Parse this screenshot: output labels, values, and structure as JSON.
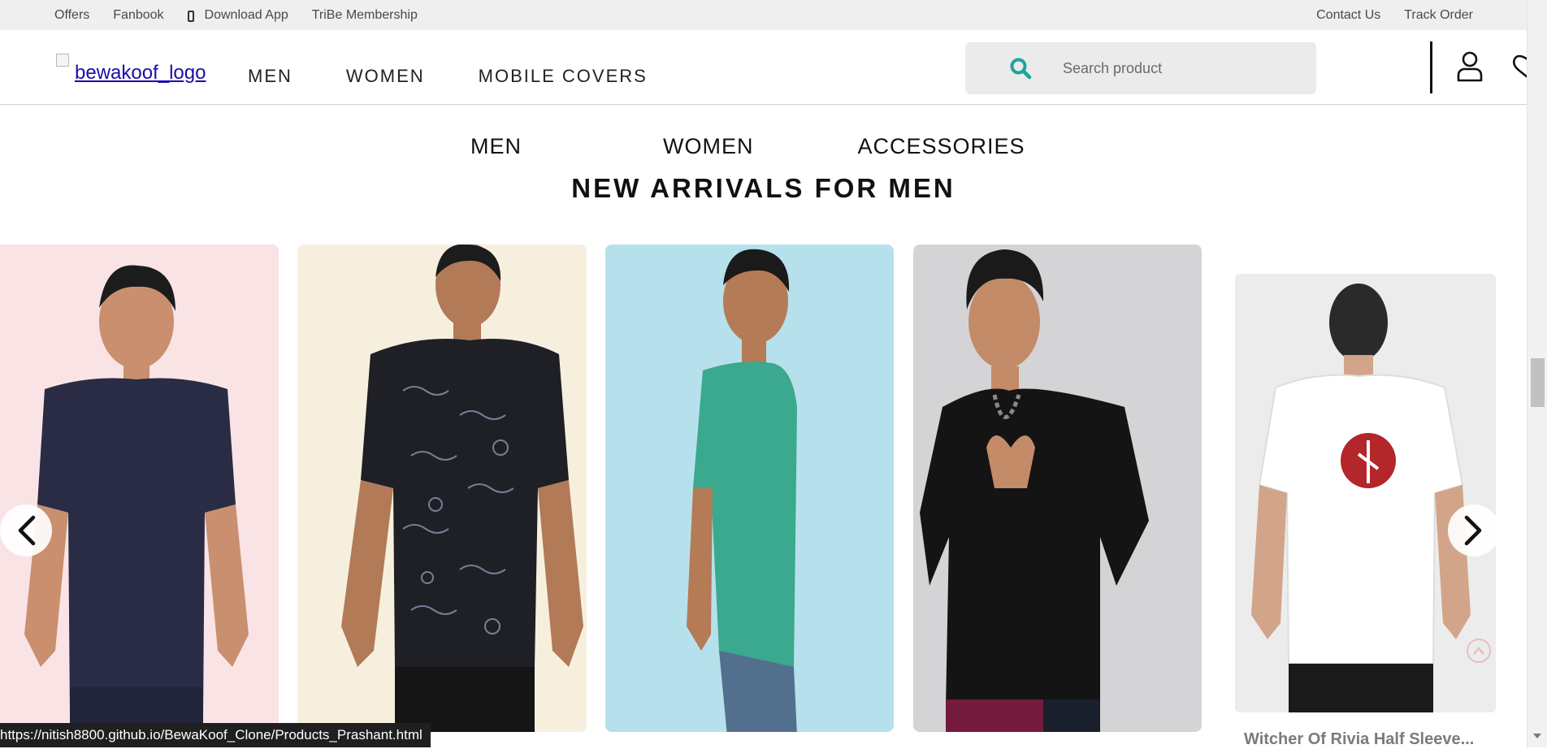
{
  "topbar": {
    "left_links": [
      "Offers",
      "Fanbook",
      "Download App",
      "TriBe Membership"
    ],
    "right_links": [
      "Contact Us",
      "Track Order"
    ]
  },
  "header": {
    "logo_alt": "bewakoof_logo",
    "nav": [
      "MEN",
      "WOMEN",
      "MOBILE COVERS"
    ],
    "search_placeholder": "Search product"
  },
  "category_tabs": [
    "MEN",
    "WOMEN",
    "ACCESSORIES"
  ],
  "section_title": "NEW ARRIVALS FOR MEN",
  "carousel": {
    "cards": [
      {
        "shirt_color": "#2a2b44"
      },
      {
        "shirt_color": "#1f2026"
      },
      {
        "shirt_color": "#3aa98d"
      },
      {
        "shirt_color": "#141414"
      },
      {
        "shirt_color": "#ffffff",
        "title": "Witcher Of Rivia Half Sleeve..."
      }
    ]
  },
  "status_url": "https://nitish8800.github.io/BewaKoof_Clone/Products_Prashant.html",
  "colors": {
    "topbar_bg": "#efefef",
    "search_accent": "#1aa5a0",
    "text_dark": "#111111"
  }
}
